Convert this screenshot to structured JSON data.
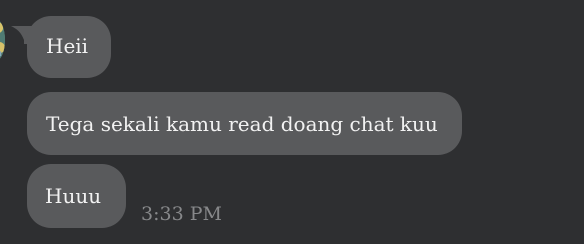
{
  "messages": [
    {
      "text": "Heii"
    },
    {
      "text": "Tega sekali kamu read doang chat kuu"
    },
    {
      "text": "Huuu"
    }
  ],
  "last_timestamp": "3:33 PM",
  "icons": {
    "avatar": "avatar-image",
    "tail": "bubble-tail"
  },
  "colors": {
    "background": "#2e2f31",
    "bubble": "#595a5c",
    "text": "#f2f2f2",
    "timestamp": "#87888a"
  }
}
